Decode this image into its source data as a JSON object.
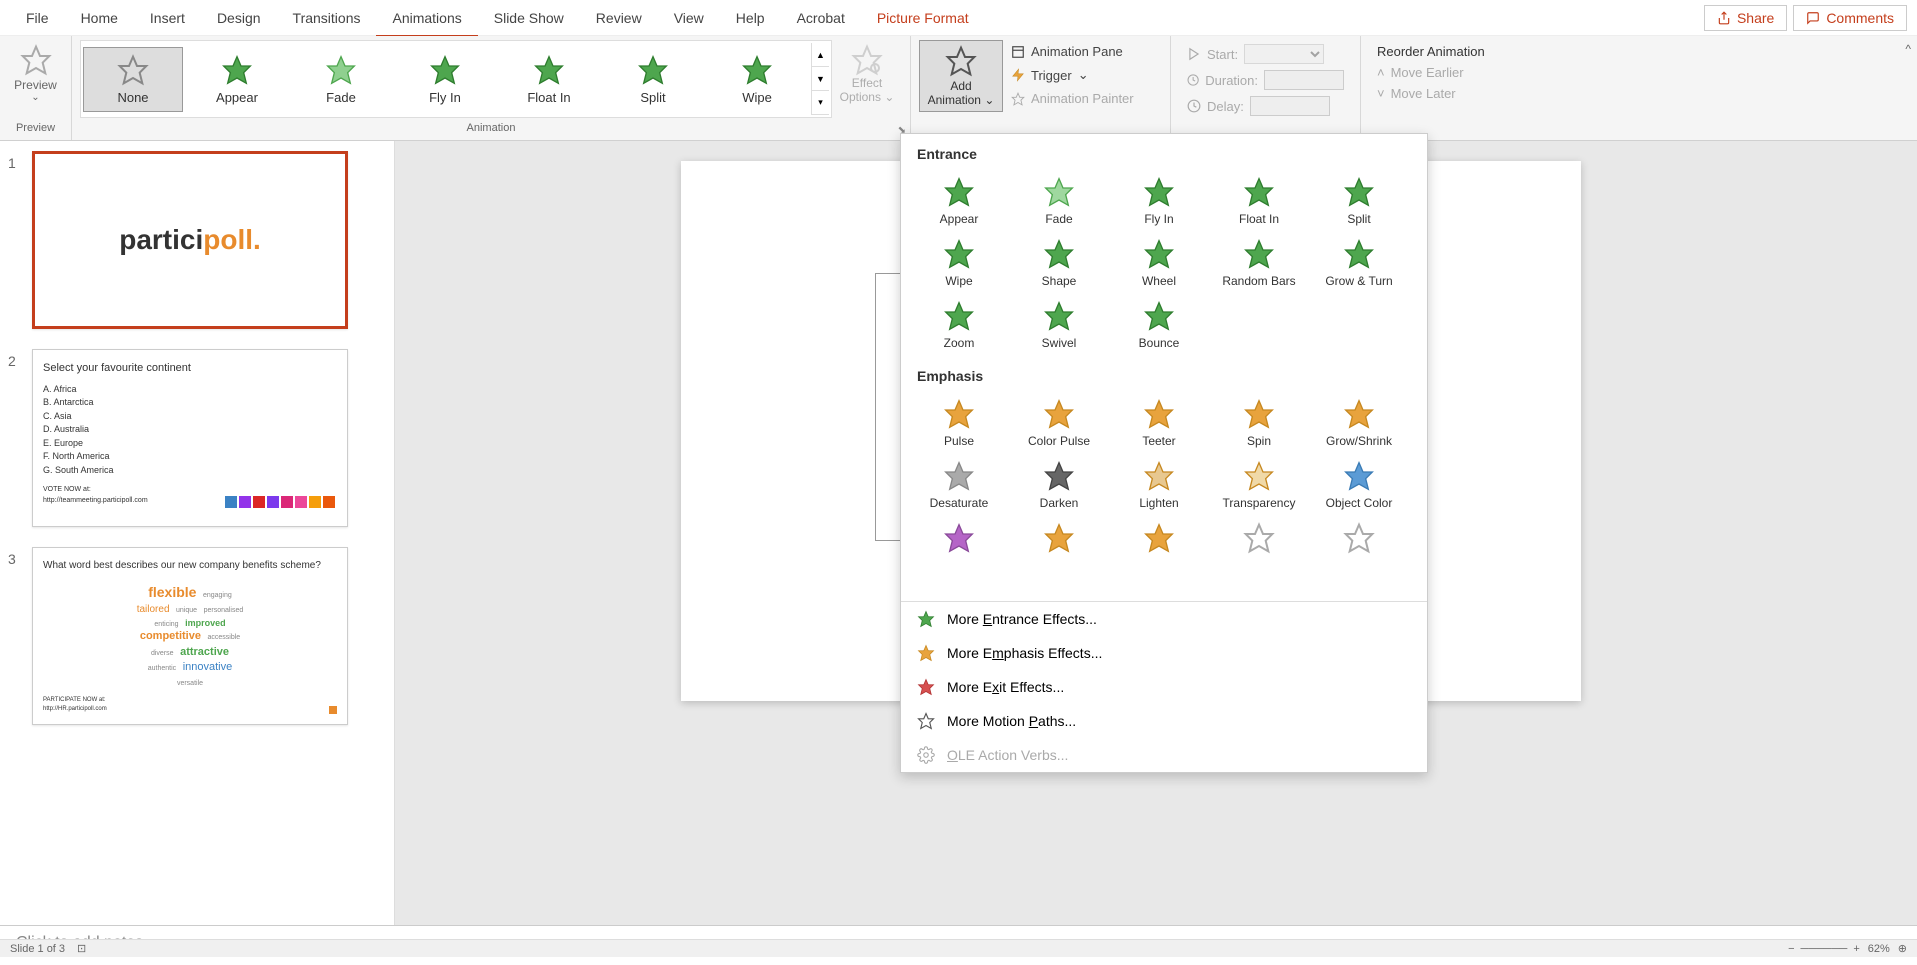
{
  "menu": {
    "items": [
      "File",
      "Home",
      "Insert",
      "Design",
      "Transitions",
      "Animations",
      "Slide Show",
      "Review",
      "View",
      "Help",
      "Acrobat",
      "Picture Format"
    ],
    "active_index": 5,
    "contextual_index": 11,
    "share": "Share",
    "comments": "Comments"
  },
  "ribbon": {
    "preview_group": {
      "label": "Preview",
      "button": "Preview"
    },
    "animation_group": {
      "label": "Animation",
      "items": [
        {
          "name": "None",
          "color": "#888",
          "selected": true
        },
        {
          "name": "Appear",
          "color": "#4ea64e"
        },
        {
          "name": "Fade",
          "color": "#4ea64e"
        },
        {
          "name": "Fly In",
          "color": "#4ea64e"
        },
        {
          "name": "Float In",
          "color": "#4ea64e"
        },
        {
          "name": "Split",
          "color": "#4ea64e"
        },
        {
          "name": "Wipe",
          "color": "#4ea64e"
        }
      ],
      "effect_options": "Effect Options"
    },
    "advanced_group": {
      "add_animation": "Add Animation",
      "animation_pane": "Animation Pane",
      "trigger": "Trigger",
      "animation_painter": "Animation Painter"
    },
    "timing_group": {
      "start": "Start:",
      "duration": "Duration:",
      "delay": "Delay:"
    },
    "reorder_group": {
      "header": "Reorder Animation",
      "earlier": "Move Earlier",
      "later": "Move Later"
    }
  },
  "dropdown": {
    "entrance_header": "Entrance",
    "entrance_items": [
      "Appear",
      "Fade",
      "Fly In",
      "Float In",
      "Split",
      "Wipe",
      "Shape",
      "Wheel",
      "Random Bars",
      "Grow & Turn",
      "Zoom",
      "Swivel",
      "Bounce"
    ],
    "emphasis_header": "Emphasis",
    "emphasis_items": [
      "Pulse",
      "Color Pulse",
      "Teeter",
      "Spin",
      "Grow/Shrink",
      "Desaturate",
      "Darken",
      "Lighten",
      "Transparency",
      "Object Color"
    ],
    "more_entrance": "More Entrance Effects...",
    "more_emphasis": "More Emphasis Effects...",
    "more_exit": "More Exit Effects...",
    "more_motion": "More Motion Paths...",
    "ole_verbs": "OLE Action Verbs..."
  },
  "slides": {
    "slide1": {
      "num": "1",
      "logo_part1": "partici",
      "logo_part2": "poll."
    },
    "slide2": {
      "num": "2",
      "title": "Select your favourite continent",
      "options": [
        "A.  Africa",
        "B.  Antarctica",
        "C.  Asia",
        "D.  Australia",
        "E.  Europe",
        "F.  North America",
        "G.  South America"
      ],
      "vote": "VOTE NOW at:",
      "url": "http://teammeeting.participoll.com",
      "colors": [
        "#3B82C4",
        "#9333EA",
        "#DC2626",
        "#7C3AED",
        "#DB2777",
        "#EC4899",
        "#F59E0B",
        "#EA580C"
      ]
    },
    "slide3": {
      "num": "3",
      "title": "What word best describes our new company benefits scheme?",
      "participate": "PARTICIPATE NOW at:",
      "url": "http://HR.participoll.com",
      "words": [
        "flexible",
        "engaging",
        "tailored",
        "unique",
        "personalised",
        "enticing",
        "improved",
        "competitive",
        "accessible",
        "diverse",
        "attractive",
        "authentic",
        "innovative",
        "versatile"
      ]
    }
  },
  "canvas": {
    "logo_visible": "part"
  },
  "notes": {
    "placeholder": "Click to add notes"
  },
  "status": {
    "slide_info": "Slide 1 of 3",
    "zoom": "62%"
  }
}
